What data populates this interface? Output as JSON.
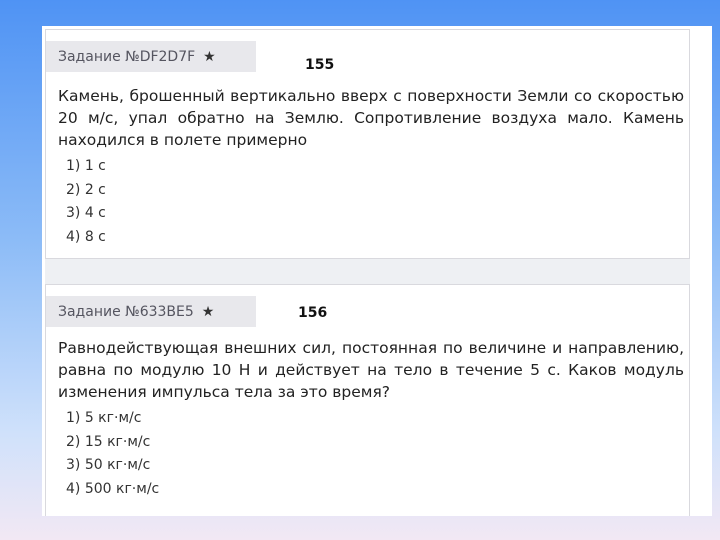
{
  "tasks": [
    {
      "header": "Задание №DF2D7F",
      "slide_number": "155",
      "question": "Камень, брошенный вертикально вверх с поверхности Земли со скоростью 20 м/с, упал обратно на Землю. Сопротивление воздуха мало. Камень находился в полете примерно",
      "answers": [
        "1) 1 с",
        "2) 2 с",
        "3) 4 с",
        "4) 8 с"
      ]
    },
    {
      "header": "Задание №633BE5",
      "slide_number": "156",
      "question": "Равнодействующая внешних сил, постоянная по величине и направлению, равна по модулю 10 Н и действует на тело в течение 5 с. Каков модуль изменения импульса тела за это время?",
      "answers": [
        "1) 5 кг·м/с",
        "2) 15 кг·м/с",
        "3) 50 кг·м/с",
        "4) 500 кг·м/с"
      ]
    }
  ],
  "icons": {
    "favorite": "star-icon"
  }
}
